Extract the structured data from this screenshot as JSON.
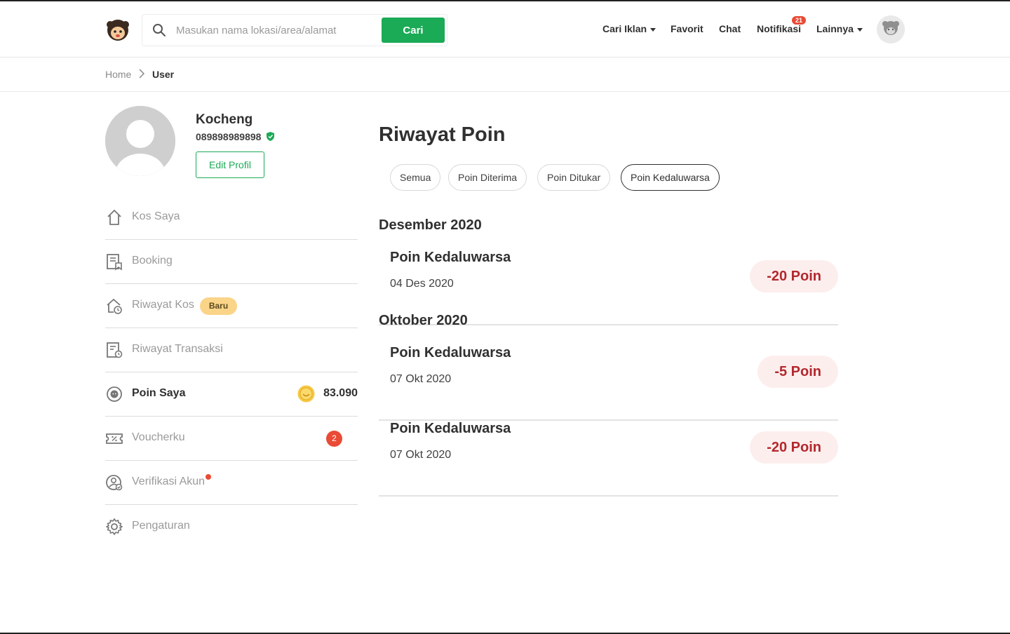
{
  "header": {
    "search": {
      "placeholder": "Masukan nama lokasi/area/alamat",
      "value": "",
      "button_label": "Cari"
    },
    "nav": {
      "cari_iklan": "Cari Iklan",
      "favorit": "Favorit",
      "chat": "Chat",
      "notifikasi": "Notifikasi",
      "notifikasi_count": "21",
      "lainnya": "Lainnya"
    }
  },
  "breadcrumb": {
    "home": "Home",
    "current": "User"
  },
  "profile": {
    "name": "Kocheng",
    "phone": "089898989898",
    "edit_label": "Edit Profil"
  },
  "sidebar": {
    "items": [
      {
        "label": "Kos Saya",
        "icon": "home-icon"
      },
      {
        "label": "Booking",
        "icon": "booking-icon"
      },
      {
        "label": "Riwayat Kos",
        "icon": "history-home-icon",
        "badge": "Baru"
      },
      {
        "label": "Riwayat Transaksi",
        "icon": "transaction-icon"
      },
      {
        "label": "Poin Saya",
        "icon": "point-icon",
        "active": true,
        "points": "83.090"
      },
      {
        "label": "Voucherku",
        "icon": "voucher-icon",
        "count": "2"
      },
      {
        "label": "Verifikasi Akun",
        "icon": "verify-user-icon",
        "dot": true
      },
      {
        "label": "Pengaturan",
        "icon": "gear-icon"
      }
    ]
  },
  "main": {
    "title": "Riwayat Poin",
    "filters": [
      {
        "label": "Semua",
        "active": false
      },
      {
        "label": "Poin Diterima",
        "active": false
      },
      {
        "label": "Poin Ditukar",
        "active": false
      },
      {
        "label": "Poin Kedaluwarsa",
        "active": true
      }
    ],
    "groups": [
      {
        "month": "Desember 2020",
        "entries": [
          {
            "title": "Poin Kedaluwarsa",
            "date": "04 Des 2020",
            "amount": "-20 Poin"
          }
        ]
      },
      {
        "month": "Oktober 2020",
        "entries": [
          {
            "title": "Poin Kedaluwarsa",
            "date": "07 Okt 2020",
            "amount": "-5 Poin"
          },
          {
            "title": "Poin Kedaluwarsa",
            "date": "07 Okt 2020",
            "amount": "-20 Poin"
          }
        ]
      }
    ]
  },
  "colors": {
    "brand_green": "#1baa56",
    "negative_red": "#b3282d",
    "negative_bg": "#fdeeee",
    "badge_red": "#e94b35",
    "badge_yellow": "#fad488"
  }
}
